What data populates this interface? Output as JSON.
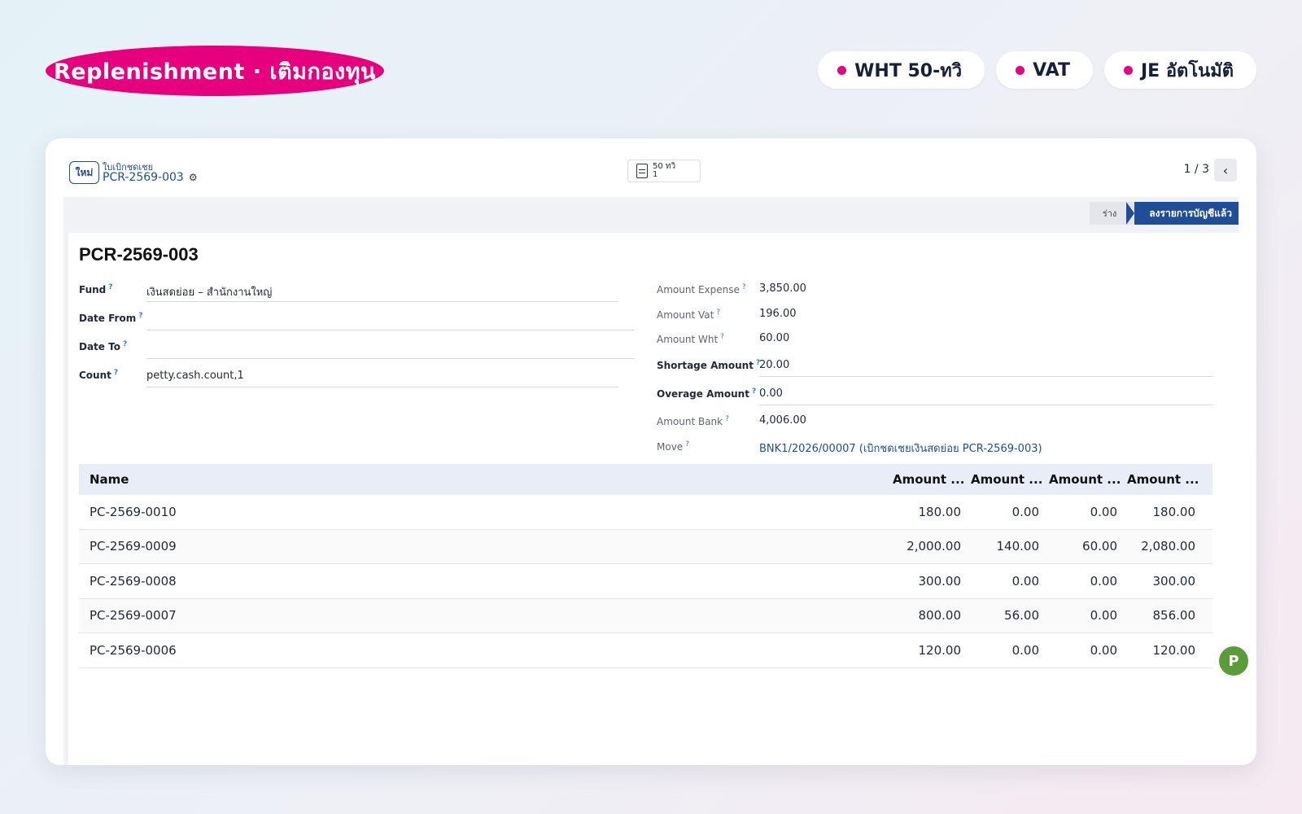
{
  "banner": {
    "title": "Replenishment · เติมกองทุน",
    "tags": [
      "WHT 50-ทวิ",
      "VAT",
      "JE อัตโนมัติ"
    ]
  },
  "colors": {
    "accent": "#e6007e",
    "brand": "#1f4e97",
    "link": "#1d4f91"
  },
  "topbar": {
    "new_label": "ใหม่",
    "breadcrumb_parent": "ใบเบิกชดเชย",
    "breadcrumb_current": "PCR-2569-003",
    "attachment_line1": "50 ทวิ",
    "attachment_line2": "1",
    "pager": "1 / 3"
  },
  "status": {
    "draft": "ร่าง",
    "posted": "ลงรายการบัญชีแล้ว"
  },
  "record": {
    "title": "PCR-2569-003",
    "left_fields": [
      {
        "label": "Fund",
        "value": "เงินสดย่อย – สำนักงานใหญ่"
      },
      {
        "label": "Date From",
        "value": ""
      },
      {
        "label": "Date To",
        "value": ""
      },
      {
        "label": "Count",
        "value": "petty.cash.count,1"
      }
    ],
    "right_fields": [
      {
        "label": "Amount Expense",
        "value": "3,850.00"
      },
      {
        "label": "Amount Vat",
        "value": "196.00"
      },
      {
        "label": "Amount Wht",
        "value": "60.00"
      },
      {
        "label": "Shortage Amount",
        "value": "20.00"
      },
      {
        "label": "Overage Amount",
        "value": "0.00"
      },
      {
        "label": "Amount Bank",
        "value": "4,006.00"
      },
      {
        "label": "Move",
        "value": "BNK1/2026/00007 (เบิกชดเชยเงินสดย่อย PCR-2569-003)"
      }
    ]
  },
  "table": {
    "headers": [
      "Name",
      "Amount ...",
      "Amount ...",
      "Amount ...",
      "Amount ..."
    ],
    "rows": [
      [
        "PC-2569-0010",
        "180.00",
        "0.00",
        "0.00",
        "180.00"
      ],
      [
        "PC-2569-0009",
        "2,000.00",
        "140.00",
        "60.00",
        "2,080.00"
      ],
      [
        "PC-2569-0008",
        "300.00",
        "0.00",
        "0.00",
        "300.00"
      ],
      [
        "PC-2569-0007",
        "800.00",
        "56.00",
        "0.00",
        "856.00"
      ],
      [
        "PC-2569-0006",
        "120.00",
        "0.00",
        "0.00",
        "120.00"
      ]
    ]
  },
  "avatar_letter": "P"
}
